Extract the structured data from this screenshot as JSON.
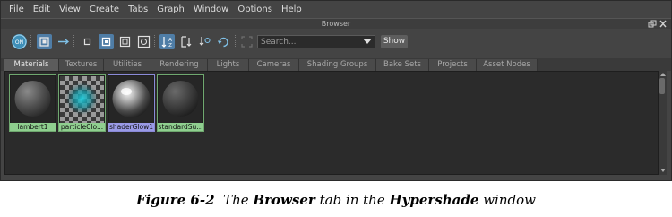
{
  "menubar": {
    "items": [
      "File",
      "Edit",
      "View",
      "Create",
      "Tabs",
      "Graph",
      "Window",
      "Options",
      "Help"
    ]
  },
  "window": {
    "title": "Browser"
  },
  "toolbar": {
    "on_label": "ON",
    "search_placeholder": "Search...",
    "show_label": "Show"
  },
  "tabs": [
    "Materials",
    "Textures",
    "Utilities",
    "Rendering",
    "Lights",
    "Cameras",
    "Shading Groups",
    "Bake Sets",
    "Projects",
    "Asset Nodes"
  ],
  "active_tab": "Materials",
  "swatches": [
    {
      "name": "lambert1",
      "type": "lambert",
      "selected": false
    },
    {
      "name": "particleClo...",
      "type": "particle-cloud",
      "selected": false
    },
    {
      "name": "shaderGlow1",
      "type": "shader-glow",
      "selected": true
    },
    {
      "name": "standardSu...",
      "type": "standard-surface",
      "selected": false
    }
  ],
  "caption": {
    "figure": "Figure 6-2",
    "t1": "The",
    "b1": "Browser",
    "t2": "tab in the",
    "b2": "Hypershade",
    "t3": "window"
  },
  "colors": {
    "accent": "#4f7da6",
    "swatch_label": "#8fcf8f",
    "selected_label": "#9a9ae6",
    "panel": "#444444"
  }
}
